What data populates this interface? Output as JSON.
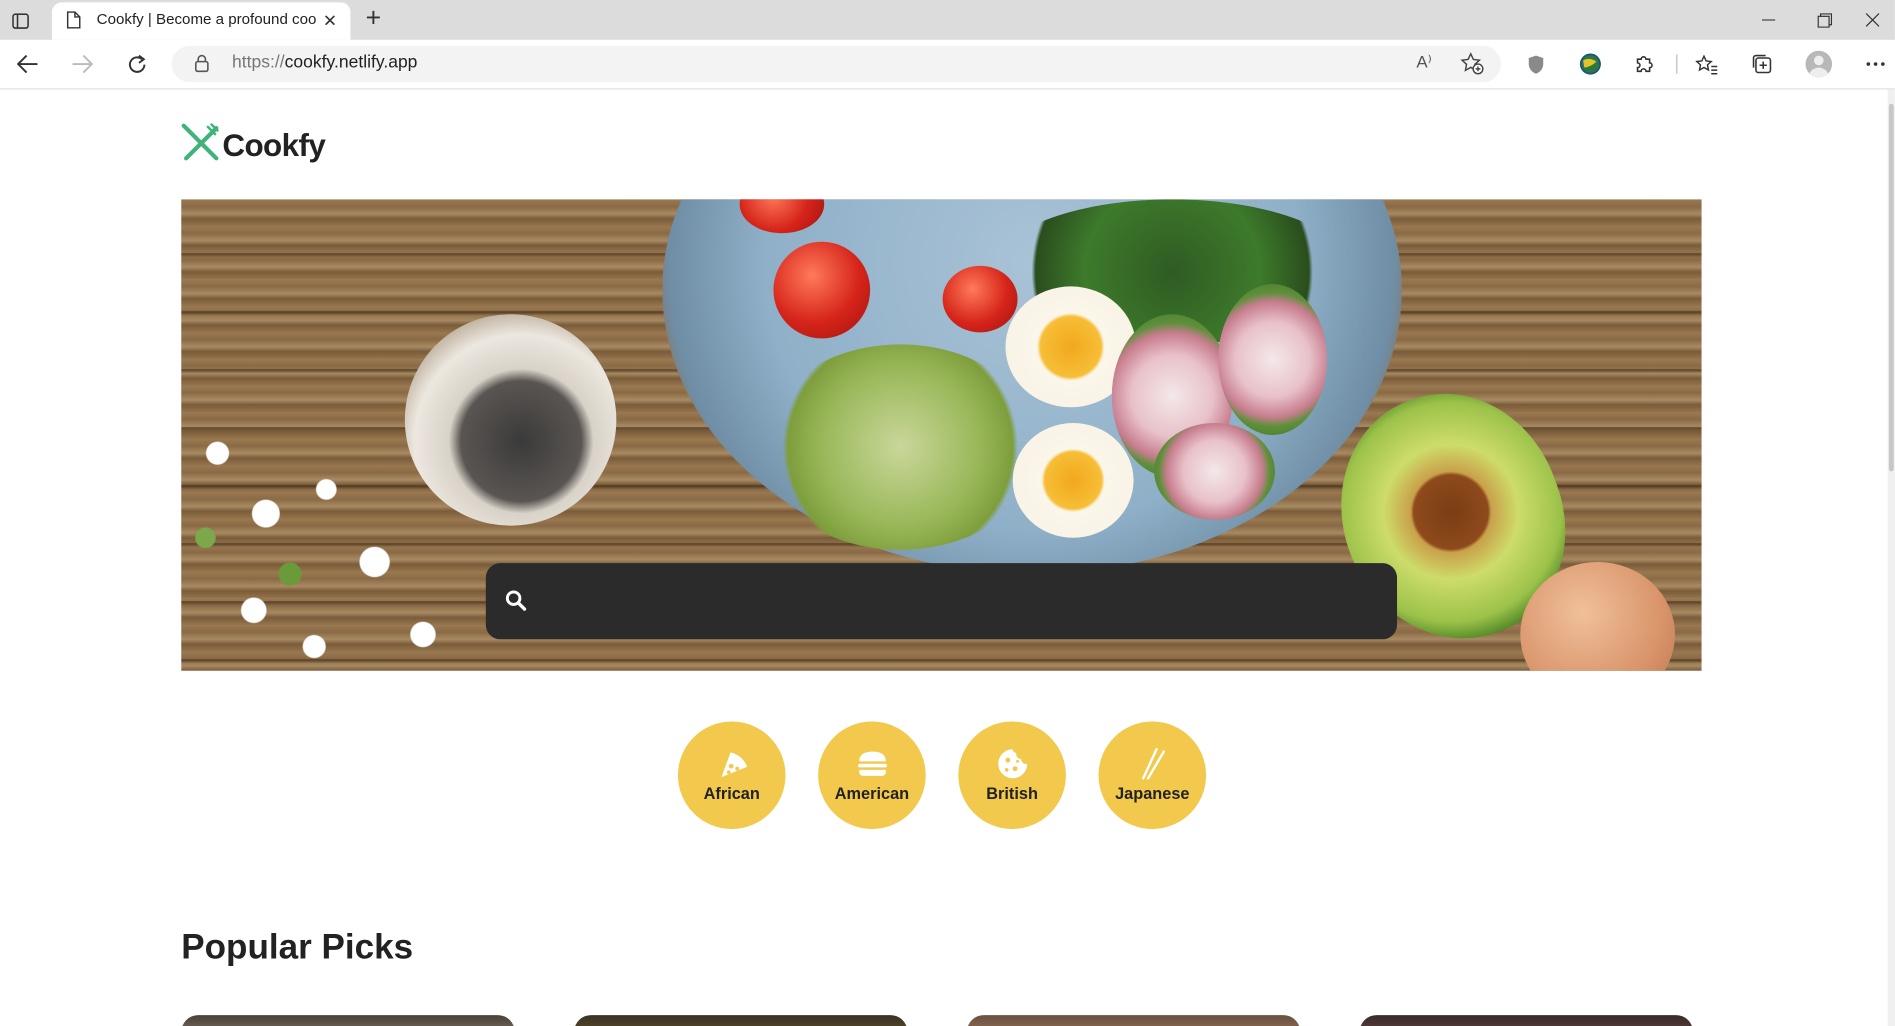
{
  "browser": {
    "tab_title": "Cookfy | Become a profound coo",
    "url_protocol": "https://",
    "url_host": "cookfy.netlify.app",
    "read_aloud": "A⁾"
  },
  "site": {
    "brand": "Cookfy",
    "accent_color": "#f2c94c",
    "brand_color": "#3fb37a"
  },
  "search": {
    "value": "",
    "placeholder": ""
  },
  "cuisines": [
    {
      "label": "African",
      "icon": "pizza-icon"
    },
    {
      "label": "American",
      "icon": "burger-icon"
    },
    {
      "label": "British",
      "icon": "cookie-icon"
    },
    {
      "label": "Japanese",
      "icon": "chopsticks-icon"
    }
  ],
  "sections": {
    "popular_title": "Popular Picks"
  }
}
